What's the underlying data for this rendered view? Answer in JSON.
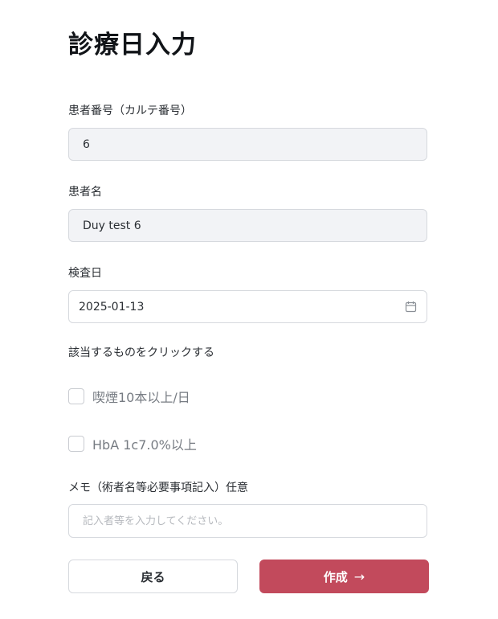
{
  "page": {
    "title": "診療日入力"
  },
  "form": {
    "patient_number": {
      "label": "患者番号（カルテ番号）",
      "value": "6"
    },
    "patient_name": {
      "label": "患者名",
      "value": "Duy test 6"
    },
    "exam_date": {
      "label": "検査日",
      "value": "2025-01-13",
      "icon": "calendar-icon"
    },
    "conditions": {
      "label": "該当するものをクリックする",
      "options": [
        {
          "label": "喫煙10本以上/日",
          "checked": false
        },
        {
          "label": "HbA 1c7.0%以上",
          "checked": false
        }
      ]
    },
    "memo": {
      "label": "メモ（術者名等必要事項記入）任意",
      "placeholder": "記入者等を入力してください。",
      "value": ""
    }
  },
  "actions": {
    "back_label": "戻る",
    "create_label": "作成",
    "create_icon": "arrow-right-icon",
    "create_color": "#c24a5c"
  }
}
